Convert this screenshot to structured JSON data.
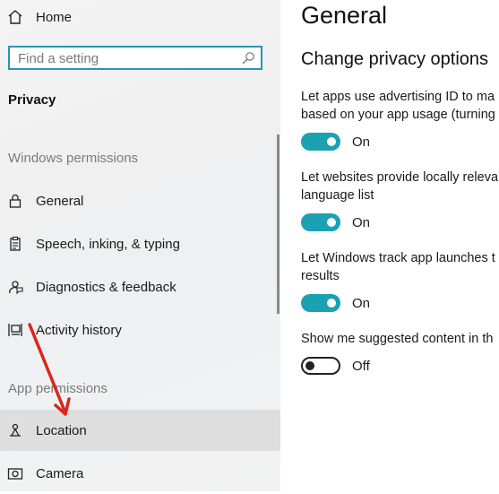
{
  "sidebar": {
    "home_label": "Home",
    "search": {
      "placeholder": "Find a setting",
      "value": ""
    },
    "privacy_heading": "Privacy",
    "windows_permissions_heading": "Windows permissions",
    "windows_items": [
      {
        "label": "General",
        "icon": "lock-icon"
      },
      {
        "label": "Speech, inking, & typing",
        "icon": "clipboard-icon"
      },
      {
        "label": "Diagnostics & feedback",
        "icon": "feedback-icon"
      },
      {
        "label": "Activity history",
        "icon": "timeline-icon"
      }
    ],
    "app_permissions_heading": "App permissions",
    "app_items": [
      {
        "label": "Location",
        "icon": "location-icon",
        "selected": true
      },
      {
        "label": "Camera",
        "icon": "camera-icon"
      }
    ]
  },
  "main": {
    "title": "General",
    "section_title": "Change privacy options",
    "options": [
      {
        "lines": [
          "Let apps use advertising ID to ma",
          "based on your app usage (turning"
        ],
        "state": "On",
        "on": true
      },
      {
        "lines": [
          "Let websites provide locally releva",
          "language list"
        ],
        "state": "On",
        "on": true
      },
      {
        "lines": [
          "Let Windows track app launches t",
          "results"
        ],
        "state": "On",
        "on": true
      },
      {
        "lines": [
          "Show me suggested content in th"
        ],
        "state": "Off",
        "on": false
      }
    ]
  },
  "colors": {
    "accent": "#1ba1b1",
    "search_border": "#2a96ac",
    "annotation_arrow": "#d9261c",
    "selected_row": "#dedede"
  }
}
